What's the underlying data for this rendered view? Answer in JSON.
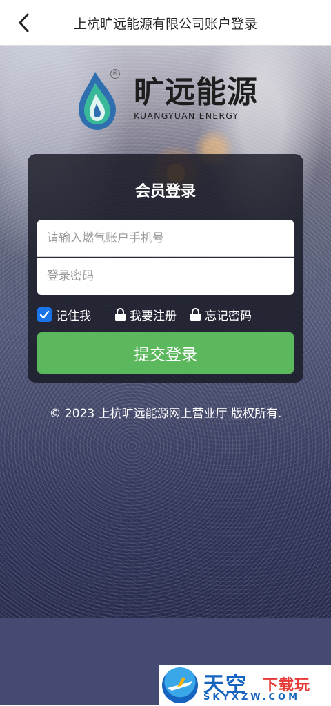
{
  "header": {
    "title": "上杭旷远能源有限公司账户登录",
    "back_icon": "chevron-left-icon"
  },
  "logo": {
    "title": "旷远能源",
    "subtitle": "KUANGYUAN ENERGY",
    "registered_mark": "®",
    "colors": {
      "drop_top": "#2f6fb0",
      "drop_bottom": "#3ab89a"
    }
  },
  "login": {
    "title": "会员登录",
    "phone_placeholder": "请输入燃气账户手机号",
    "password_placeholder": "登录密码",
    "remember_label": "记住我",
    "remember_checked": true,
    "register_label": "我要注册",
    "forgot_label": "忘记密码",
    "submit_label": "提交登录",
    "colors": {
      "submit": "#5cb85c",
      "checkbox": "#1a73e8"
    }
  },
  "footer": {
    "copyright": "© 2023 上杭旷远能源网上营业厅 版权所有."
  },
  "watermark": {
    "main": "天空",
    "accent": "下载玩",
    "url": "SKYXZW.COM"
  }
}
